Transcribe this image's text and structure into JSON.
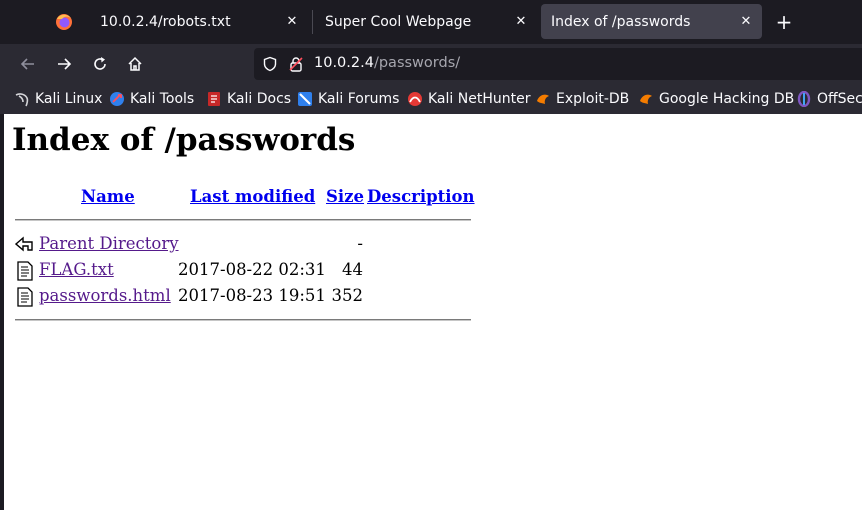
{
  "browser": {
    "tabs": [
      {
        "title": "10.0.2.4/robots.txt",
        "active": false
      },
      {
        "title": "Super Cool Webpage",
        "active": false
      },
      {
        "title": "Index of /passwords",
        "active": true
      }
    ],
    "url": {
      "host": "10.0.2.4",
      "path": "/passwords/"
    },
    "bookmarks": [
      {
        "label": "Kali Linux",
        "icon": "kali-dragon-icon"
      },
      {
        "label": "Kali Tools",
        "icon": "kali-tools-icon"
      },
      {
        "label": "Kali Docs",
        "icon": "kali-docs-icon"
      },
      {
        "label": "Kali Forums",
        "icon": "kali-forums-icon"
      },
      {
        "label": "Kali NetHunter",
        "icon": "kali-nethunter-icon"
      },
      {
        "label": "Exploit-DB",
        "icon": "exploit-db-icon"
      },
      {
        "label": "Google Hacking DB",
        "icon": "ghdb-icon"
      },
      {
        "label": "OffSec",
        "icon": "offsec-icon"
      }
    ]
  },
  "page": {
    "title": "Index of /passwords",
    "columns": {
      "name": "Name",
      "modified": "Last modified",
      "size": "Size",
      "description": "Description"
    },
    "rows": [
      {
        "icon": "back-arrow-icon",
        "name": "Parent Directory",
        "modified": "",
        "size": "-"
      },
      {
        "icon": "text-file-icon",
        "name": "FLAG.txt",
        "modified": "2017-08-22 02:31",
        "size": "44"
      },
      {
        "icon": "text-file-icon",
        "name": "passwords.html",
        "modified": "2017-08-23 19:51",
        "size": "352"
      }
    ]
  },
  "colors": {
    "link": "#0000ee",
    "visited": "#551a8b",
    "chrome_dark": "#1c1b22",
    "chrome_mid": "#2b2a33",
    "active_tab": "#42414d"
  }
}
